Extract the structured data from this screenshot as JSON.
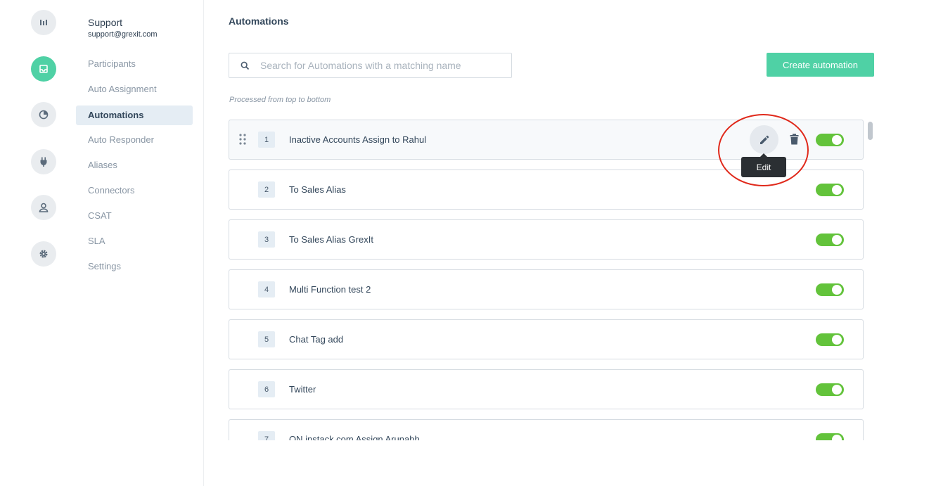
{
  "account": {
    "name": "Support",
    "email": "support@grexit.com"
  },
  "rail": [
    {
      "icon": "bar-chart-icon",
      "active": false
    },
    {
      "icon": "inbox-icon",
      "active": true
    },
    {
      "icon": "pie-chart-icon",
      "active": false
    },
    {
      "icon": "plug-icon",
      "active": false
    },
    {
      "icon": "user-icon",
      "active": false
    },
    {
      "icon": "gear-icon",
      "active": false
    }
  ],
  "nav": {
    "items": [
      {
        "label": "Participants"
      },
      {
        "label": "Auto Assignment"
      },
      {
        "label": "Automations"
      },
      {
        "label": "Auto Responder"
      },
      {
        "label": "Aliases"
      },
      {
        "label": "Connectors"
      },
      {
        "label": "CSAT"
      },
      {
        "label": "SLA"
      },
      {
        "label": "Settings"
      }
    ],
    "active": "Automations"
  },
  "main": {
    "title": "Automations",
    "search": {
      "placeholder": "Search for Automations with a matching name",
      "value": ""
    },
    "create_label": "Create automation",
    "note": "Processed from top to bottom",
    "tooltip": "Edit",
    "automations": [
      {
        "num": "1",
        "name": "Inactive Accounts Assign to Rahul",
        "enabled": true
      },
      {
        "num": "2",
        "name": "To Sales Alias",
        "enabled": true
      },
      {
        "num": "3",
        "name": "To Sales Alias GrexIt",
        "enabled": true
      },
      {
        "num": "4",
        "name": "Multi Function test 2",
        "enabled": true
      },
      {
        "num": "5",
        "name": "Chat Tag add",
        "enabled": true
      },
      {
        "num": "6",
        "name": "Twitter",
        "enabled": true
      },
      {
        "num": "7",
        "name": "ON instack.com Assign Arunabh",
        "enabled": true
      }
    ]
  },
  "colors": {
    "accent": "#4fd1a5",
    "toggle_on": "#63c33b",
    "highlight": "#e0291b"
  }
}
